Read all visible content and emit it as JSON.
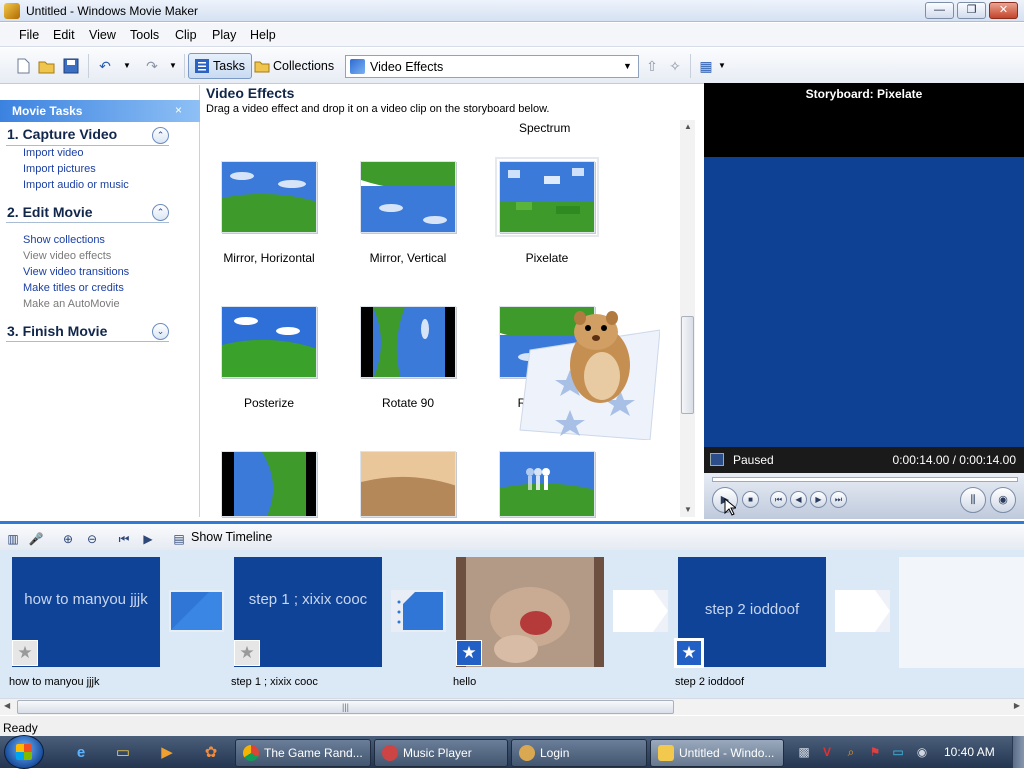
{
  "window": {
    "title": "Untitled - Windows Movie Maker",
    "controls": {
      "minimize": "—",
      "maximize": "❐",
      "close": "✕"
    }
  },
  "menu": [
    "File",
    "Edit",
    "View",
    "Tools",
    "Clip",
    "Play",
    "Help"
  ],
  "toolbar": {
    "tasks_label": "Tasks",
    "collections_label": "Collections",
    "collection_dropdown": "Video Effects",
    "icons": [
      "new-project-icon",
      "open-project-icon",
      "save-project-icon",
      "undo-icon",
      "redo-icon",
      "up-one-level-icon",
      "new-collection-folder-icon",
      "views-icon"
    ]
  },
  "tasks_pane": {
    "header": "Movie Tasks",
    "close": "×",
    "sections": [
      {
        "title": "1. Capture Video",
        "toggle": "⌃",
        "links": [
          {
            "label": "Import video",
            "enabled": true
          },
          {
            "label": "Import pictures",
            "enabled": true
          },
          {
            "label": "Import audio or music",
            "enabled": true
          }
        ]
      },
      {
        "title": "2. Edit Movie",
        "toggle": "⌃",
        "links": [
          {
            "label": "Show collections",
            "enabled": true
          },
          {
            "label": "View video effects",
            "enabled": false
          },
          {
            "label": "View video transitions",
            "enabled": true
          },
          {
            "label": "Make titles or credits",
            "enabled": true
          },
          {
            "label": "Make an AutoMovie",
            "enabled": false
          }
        ]
      },
      {
        "title": "3. Finish Movie",
        "toggle": "⌄",
        "links": []
      }
    ]
  },
  "effects_pane": {
    "title": "Video Effects",
    "subtitle": "Drag a video effect and drop it on a video clip on the storyboard below.",
    "partial_label_above": "Spectrum",
    "effects": [
      {
        "label": "Mirror, Horizontal"
      },
      {
        "label": "Mirror, Vertical"
      },
      {
        "label": "Pixelate",
        "selected": true
      },
      {
        "label": "Posterize"
      },
      {
        "label": "Rotate 90"
      },
      {
        "label": "Rotate 180"
      },
      {
        "label": ""
      },
      {
        "label": ""
      },
      {
        "label": ""
      }
    ]
  },
  "monitor": {
    "title": "Storyboard: Pixelate",
    "status": "Paused",
    "time": "0:00:14.00 / 0:00:14.00",
    "controls": [
      "▶",
      "■",
      "⏮",
      "◀",
      "▶",
      "⏭"
    ]
  },
  "timeline_toolbar": {
    "show_timeline_label": "Show Timeline"
  },
  "storyboard": {
    "clips": [
      {
        "title": "how to manyou jjjk",
        "label": "how to manyou jjjk",
        "type": "title",
        "effect_applied": false
      },
      {
        "title": "step 1 ; xixix cooc",
        "label": "step 1 ; xixix cooc",
        "type": "title",
        "effect_applied": false
      },
      {
        "title": "",
        "label": "hello",
        "type": "video",
        "effect_applied": true
      },
      {
        "title": "step 2 ioddoof",
        "label": "step 2 ioddoof",
        "type": "title",
        "effect_applied": true
      }
    ],
    "scroll_grip": "|||"
  },
  "status_bar": {
    "text": "Ready"
  },
  "taskbar": {
    "buttons": [
      {
        "label": "The Game Rand...",
        "active": false,
        "icon_color": "#e8b54a"
      },
      {
        "label": "Music Player",
        "active": false,
        "icon_color": "#c44"
      },
      {
        "label": "Login",
        "active": false,
        "icon_color": "#d9a850"
      },
      {
        "label": "Untitled - Windo...",
        "active": true,
        "icon_color": "#f2c94c"
      }
    ],
    "clock": "10:40 AM"
  },
  "colors": {
    "accent": "#2f7ad6",
    "title_card": "#0f4398",
    "panel_header": "#3b82e0"
  }
}
